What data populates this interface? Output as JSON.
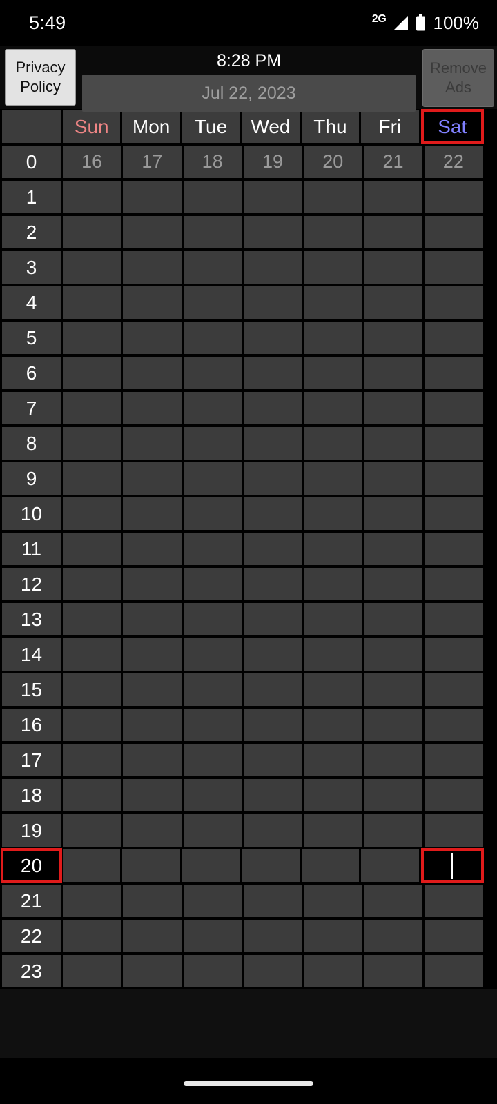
{
  "status_bar": {
    "clock": "5:49",
    "network_type": "2G",
    "battery_percent": "100%",
    "icons": [
      "signal-icon",
      "battery-icon"
    ]
  },
  "action_bar": {
    "privacy_policy_label_line1": "Privacy",
    "privacy_policy_label_line2": "Policy",
    "remove_ads_label_line1": "Remove",
    "remove_ads_label_line2": "Ads",
    "time_label": "8:28 PM",
    "date_value": "Jul 22, 2023"
  },
  "calendar": {
    "corner_label": "",
    "day_headers": [
      {
        "label": "Sun",
        "style": "dow-sun",
        "selected": false
      },
      {
        "label": "Mon",
        "style": "dow-default",
        "selected": false
      },
      {
        "label": "Tue",
        "style": "dow-default",
        "selected": false
      },
      {
        "label": "Wed",
        "style": "dow-default",
        "selected": false
      },
      {
        "label": "Thu",
        "style": "dow-default",
        "selected": false
      },
      {
        "label": "Fri",
        "style": "dow-default",
        "selected": false
      },
      {
        "label": "Sat",
        "style": "dow-sat",
        "selected": true
      }
    ],
    "date_numbers": [
      "16",
      "17",
      "18",
      "19",
      "20",
      "21",
      "22"
    ],
    "date_row_label": "0",
    "hour_labels": [
      "0",
      "1",
      "2",
      "3",
      "4",
      "5",
      "6",
      "7",
      "8",
      "9",
      "10",
      "11",
      "12",
      "13",
      "14",
      "15",
      "16",
      "17",
      "18",
      "19",
      "20",
      "21",
      "22",
      "23"
    ],
    "selected_hour": "20",
    "selected_day_index": 6,
    "selected_cell_has_caret": true
  },
  "colors": {
    "accent_selection": "#e01b1b",
    "cell_background": "#3c3c3c",
    "page_background": "#000000",
    "sunday_text": "#ef8585",
    "saturday_text": "#8080ff",
    "date_number_text": "#9a9a9a",
    "date_field_background": "#4a4a4a"
  },
  "nav_bar": {
    "home_indicator": "home-indicator"
  }
}
